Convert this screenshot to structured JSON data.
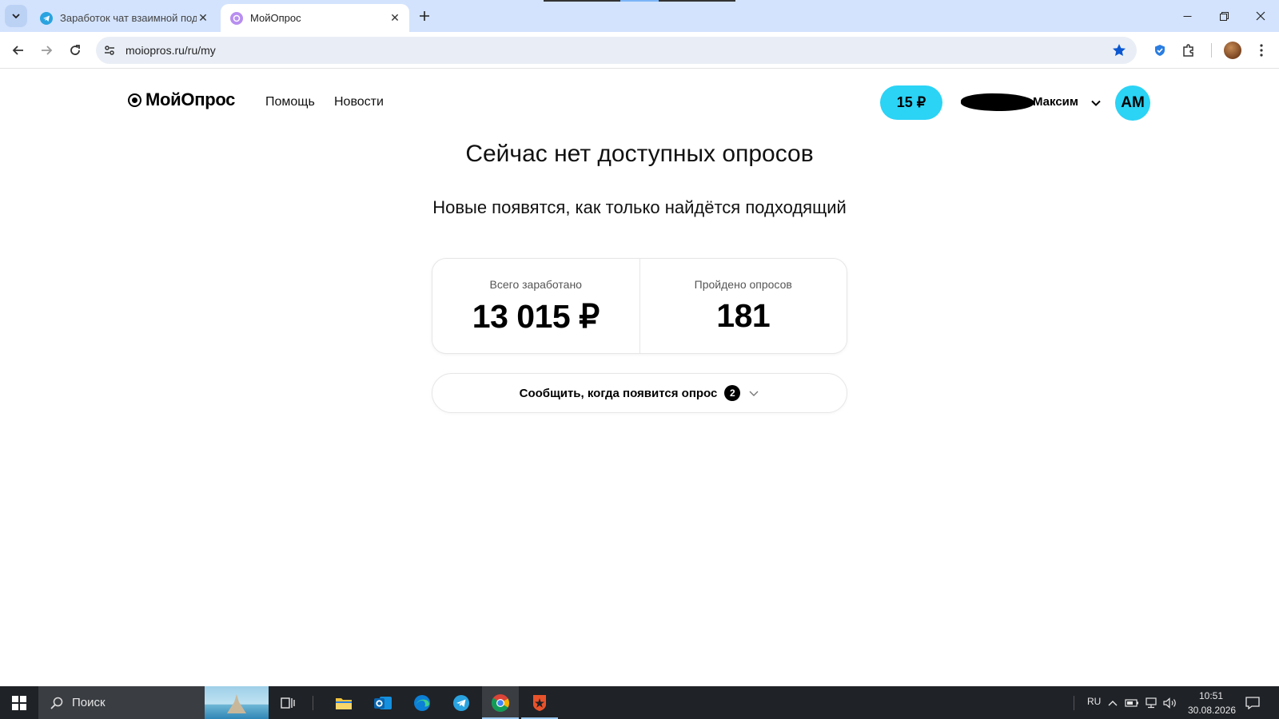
{
  "browser": {
    "tabs": [
      {
        "title": "Заработок чат взаимной подп",
        "favicon": "telegram-icon",
        "active": false
      },
      {
        "title": "МойОпрос",
        "favicon": "moiopros-icon",
        "active": true
      }
    ],
    "url": "moiopros.ru/ru/my"
  },
  "site": {
    "logo": "МойОпрос",
    "nav": [
      "Помощь",
      "Новости"
    ],
    "balance": "15 ₽",
    "user_name": "Максим",
    "avatar_initials": "АМ"
  },
  "main": {
    "headline": "Сейчас нет доступных опросов",
    "subline": "Новые появятся, как только найдётся подходящий",
    "stats": [
      {
        "label": "Всего заработано",
        "value": "13 015 ₽"
      },
      {
        "label": "Пройдено опросов",
        "value": "181"
      }
    ],
    "notify": {
      "label": "Сообщить, когда появится опрос",
      "count": "2"
    }
  },
  "taskbar": {
    "search_placeholder": "Поиск",
    "language": "RU",
    "time": "10:51",
    "date": "30.08.2026"
  },
  "colors": {
    "accent": "#2bd3f5",
    "tabbar": "#d3e3fd",
    "taskbar": "#1f2227"
  }
}
